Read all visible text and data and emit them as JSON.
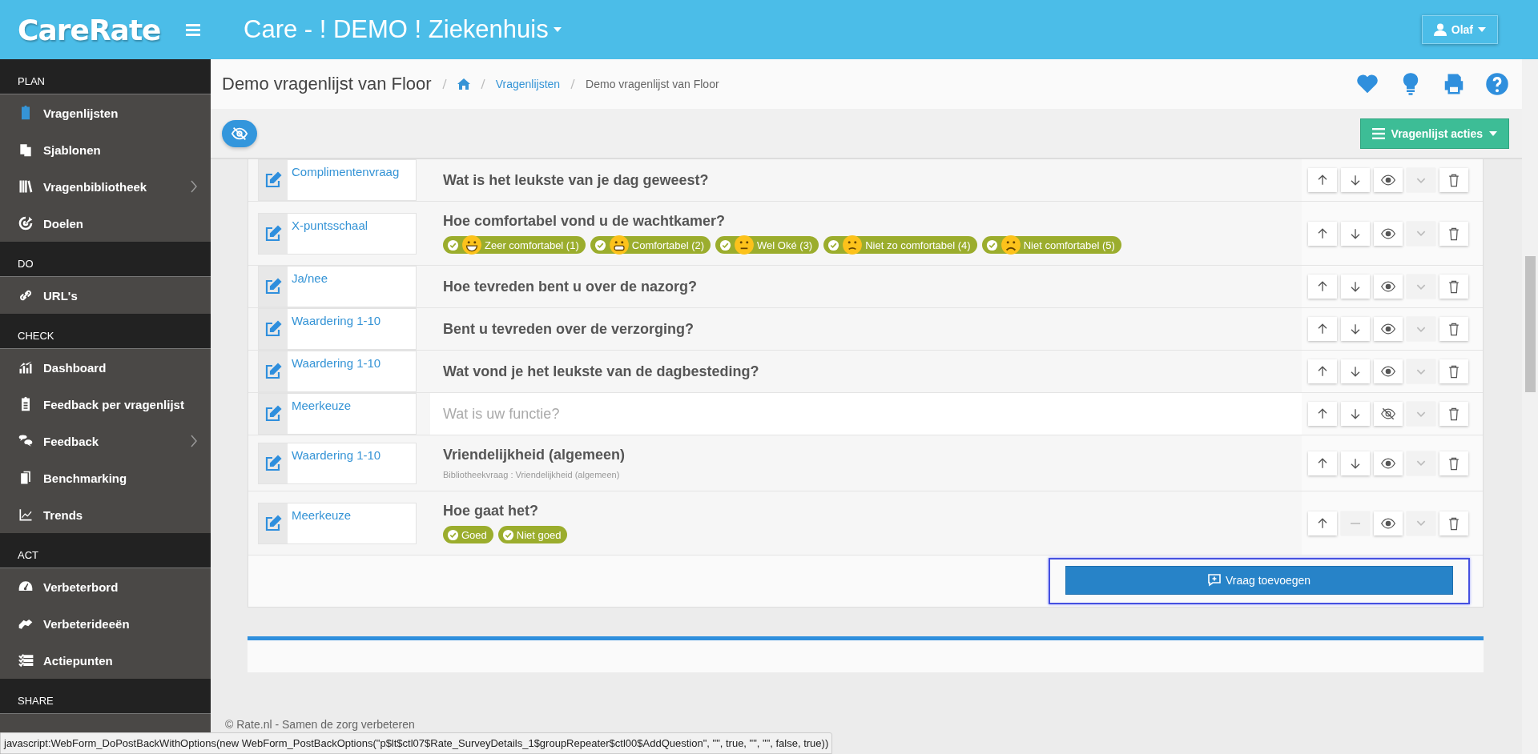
{
  "topbar": {
    "logo": "CareRate",
    "org": "Care - ! DEMO ! Ziekenhuis",
    "user": "Olaf"
  },
  "sidebar": {
    "sections": [
      {
        "title": "PLAN",
        "items": [
          {
            "label": "Vragenlijsten",
            "expandable": false,
            "selected": true
          },
          {
            "label": "Sjablonen",
            "expandable": false,
            "selected": false
          },
          {
            "label": "Vragenbibliotheek",
            "expandable": true,
            "selected": false
          },
          {
            "label": "Doelen",
            "expandable": false,
            "selected": false
          }
        ]
      },
      {
        "title": "DO",
        "items": [
          {
            "label": "URL's",
            "expandable": false,
            "selected": false
          }
        ]
      },
      {
        "title": "CHECK",
        "items": [
          {
            "label": "Dashboard",
            "expandable": false,
            "selected": false
          },
          {
            "label": "Feedback per vragenlijst",
            "expandable": false,
            "selected": false
          },
          {
            "label": "Feedback",
            "expandable": true,
            "selected": false
          },
          {
            "label": "Benchmarking",
            "expandable": false,
            "selected": false
          },
          {
            "label": "Trends",
            "expandable": false,
            "selected": false
          }
        ]
      },
      {
        "title": "ACT",
        "items": [
          {
            "label": "Verbeterbord",
            "expandable": false,
            "selected": false
          },
          {
            "label": "Verbeterideeën",
            "expandable": false,
            "selected": false
          },
          {
            "label": "Actiepunten",
            "expandable": false,
            "selected": false
          }
        ]
      },
      {
        "title": "SHARE"
      }
    ]
  },
  "header": {
    "title": "Demo vragenlijst van Floor",
    "breadcrumbs": [
      {
        "kind": "home"
      },
      {
        "kind": "link",
        "label": "Vragenlijsten"
      },
      {
        "kind": "text",
        "label": "Demo vragenlijst van Floor"
      }
    ]
  },
  "toolbar": {
    "actions_button": "Vragenlijst acties"
  },
  "questions": [
    {
      "type": "Complimentenvraag",
      "text": "Wat is het leukste van je dag geweest?",
      "hidden": false,
      "can_move_down": true
    },
    {
      "type": "X-puntsschaal",
      "text": "Hoe comfortabel vond u de wachtkamer?",
      "hidden": false,
      "can_move_down": true,
      "options": [
        {
          "label": "Zeer comfortabel (1)",
          "kind": "smiley"
        },
        {
          "label": "Comfortabel (2)",
          "kind": "smiley"
        },
        {
          "label": "Wel Oké (3)",
          "kind": "smiley"
        },
        {
          "label": "Niet zo comfortabel (4)",
          "kind": "smiley"
        },
        {
          "label": "Niet comfortabel (5)",
          "kind": "smiley"
        }
      ]
    },
    {
      "type": "Ja/nee",
      "text": "Hoe tevreden bent u over de nazorg?",
      "hidden": false,
      "can_move_down": true
    },
    {
      "type": "Waardering 1-10",
      "text": "Bent u tevreden over de verzorging?",
      "hidden": false,
      "can_move_down": true
    },
    {
      "type": "Waardering 1-10",
      "text": "Wat vond je het leukste van de dagbesteding?",
      "hidden": false,
      "can_move_down": true
    },
    {
      "type": "Meerkeuze",
      "text": "Wat is uw functie?",
      "hidden": true,
      "can_move_down": true
    },
    {
      "type": "Waardering 1-10",
      "text": "Vriendelijkheid (algemeen)",
      "subtext": "Bibliotheekvraag : Vriendelijkheid (algemeen)",
      "hidden": false,
      "can_move_down": true
    },
    {
      "type": "Meerkeuze",
      "text": "Hoe gaat het?",
      "hidden": false,
      "can_move_down": false,
      "options": [
        {
          "label": "Goed",
          "kind": "plain"
        },
        {
          "label": "Niet goed",
          "kind": "plain"
        }
      ]
    }
  ],
  "add_button": "Vraag toevoegen",
  "footer": "© Rate.nl - Samen de zorg verbeteren",
  "status_bar": "javascript:WebForm_DoPostBackWithOptions(new WebForm_PostBackOptions(\"p$lt$ctl07$Rate_SurveyDetails_1$groupRepeater$ctl00$AddQuestion\", \"\", true, \"\", \"\", false, true))"
}
